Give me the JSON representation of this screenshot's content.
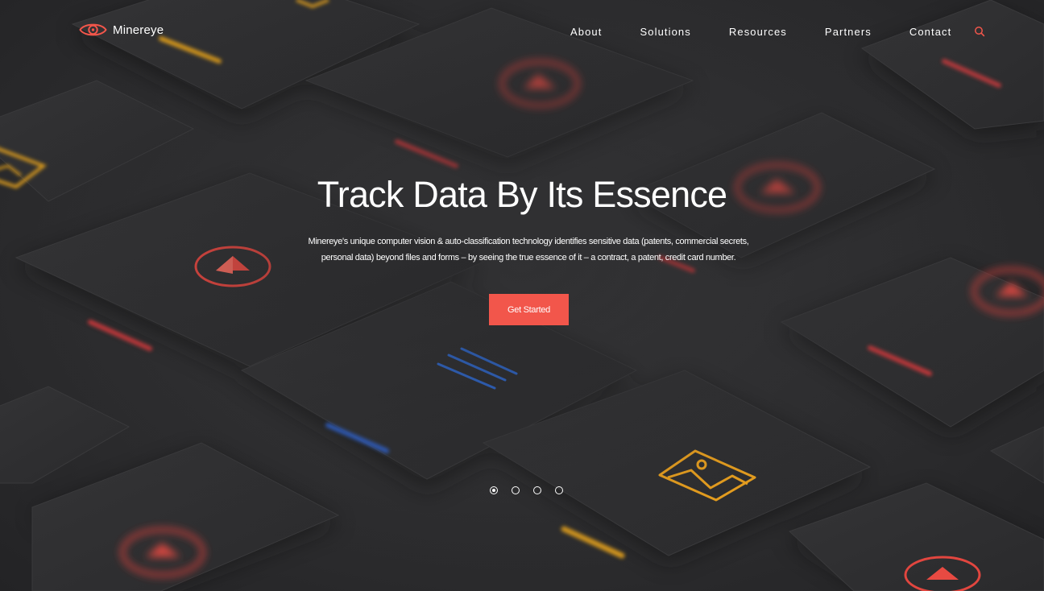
{
  "brand": {
    "name": "Minereye",
    "accent_color": "#f2564b",
    "logo_icon": "eye-icon"
  },
  "nav": {
    "items": [
      {
        "label": "About"
      },
      {
        "label": "Solutions"
      },
      {
        "label": "Resources"
      },
      {
        "label": "Partners"
      },
      {
        "label": "Contact"
      }
    ],
    "search_icon": "search-icon"
  },
  "hero": {
    "title": "Track Data By Its Essence",
    "description_line1": "Minereye's unique computer vision & auto-classification technology identifies sensitive data  (patents, commercial secrets,",
    "description_line2": "personal data) beyond files and forms – by seeing the true essence of it – a contract, a patent, credit card number.",
    "cta_label": "Get Started",
    "background_colors": {
      "red": "#e2463f",
      "yellow": "#f1a51e",
      "blue": "#2f6fe0"
    }
  },
  "carousel": {
    "slide_count": 4,
    "active_index": 0
  }
}
